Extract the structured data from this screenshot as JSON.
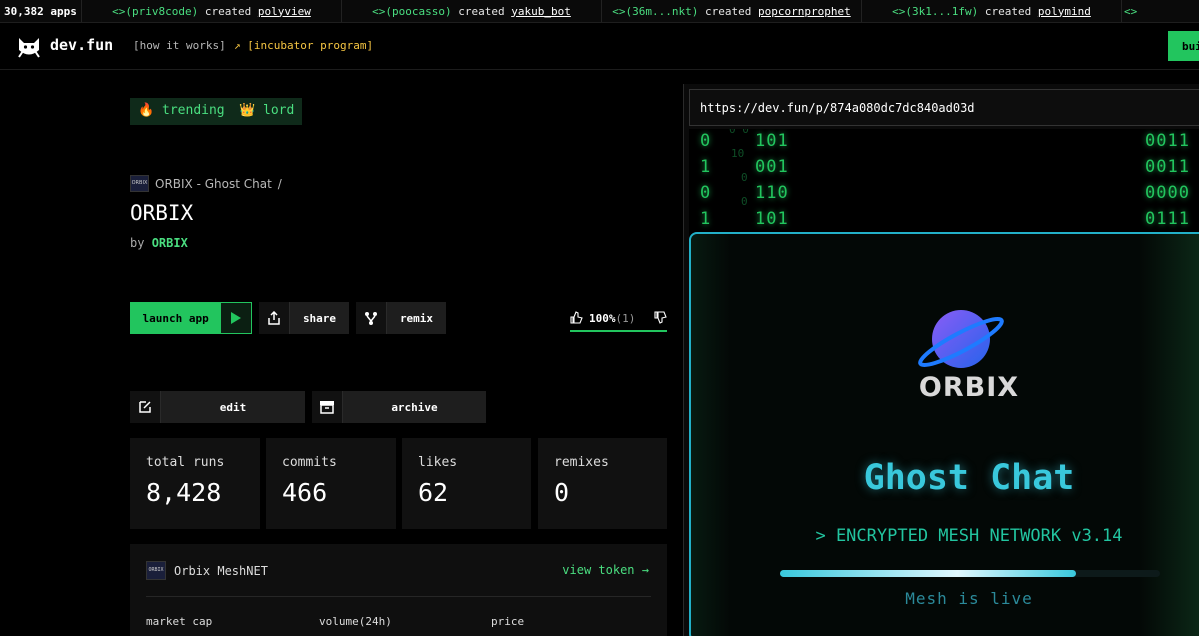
{
  "ticker": {
    "count": "30,382 apps",
    "items": [
      {
        "who": "<>(priv8code)",
        "verb": " created ",
        "app": "polyview"
      },
      {
        "who": "<>(poocasso)",
        "verb": " created ",
        "app": "yakub_bot"
      },
      {
        "who": "<>(36m...nkt)",
        "verb": " created ",
        "app": "popcornprophet"
      },
      {
        "who": "<>(3k1...1fw)",
        "verb": " created ",
        "app": "polymind"
      },
      {
        "who": "<>",
        "verb": "",
        "app": ""
      }
    ]
  },
  "header": {
    "brand": "dev.fun",
    "how": "[how it works]",
    "incubator": "[incubator program]",
    "build": "bui"
  },
  "badges": {
    "trending": "trending",
    "lord": "lord"
  },
  "app": {
    "crumb": "ORBIX - Ghost Chat",
    "crumb_sep": "/",
    "crumb_logo": "ORBIX",
    "title": "ORBIX",
    "by_label": "by",
    "by_name": "ORBIX"
  },
  "actions": {
    "launch": "launch app",
    "share": "share",
    "remix": "remix",
    "edit": "edit",
    "archive": "archive"
  },
  "vote": {
    "pct": "100%",
    "count": "(1)"
  },
  "stats": {
    "runs_label": "total runs",
    "runs": "8,428",
    "commits_label": "commits",
    "commits": "466",
    "likes_label": "likes",
    "likes": "62",
    "remixes_label": "remixes",
    "remixes": "0"
  },
  "token": {
    "name": "Orbix MeshNET",
    "logo": "ORBIX",
    "view": "view token",
    "market_cap": "market cap",
    "volume": "volume(24h)",
    "price": "price"
  },
  "preview": {
    "url": "https://dev.fun/p/874a080dc7dc840ad03d",
    "matrix": [
      {
        "a": "0",
        "b": "101",
        "c": "0011"
      },
      {
        "a": "1",
        "b": "001",
        "c": "0011"
      },
      {
        "a": "0",
        "b": "110",
        "c": "0000"
      },
      {
        "a": "1",
        "b": "101",
        "c": "0111"
      }
    ],
    "logo_word": "ORBIX",
    "headline": "Ghost Chat",
    "subline": "> ENCRYPTED MESH NETWORK v3.14",
    "status": "Mesh is live",
    "progress": 0.78
  },
  "colors": {
    "accent": "#22c55e",
    "cyan": "#39c8dc",
    "gold": "#f5c542"
  }
}
